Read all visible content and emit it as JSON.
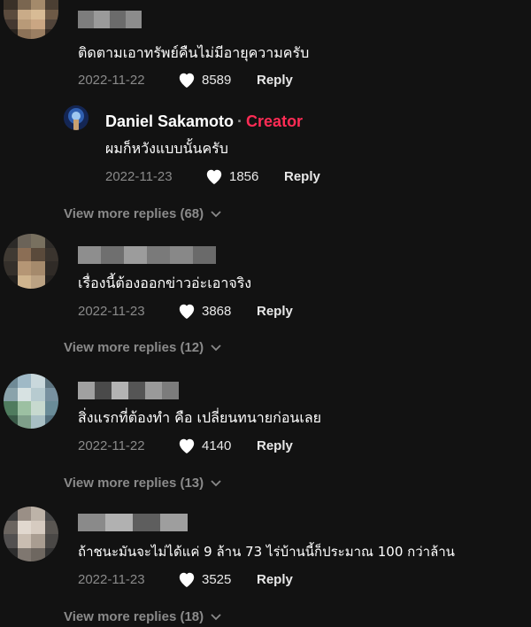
{
  "comments": [
    {
      "text": "ติดตามเอาทรัพย์คืนไม่มีอายุความครับ",
      "date": "2022-11-22",
      "likes": "8589",
      "reply_label": "Reply",
      "replies": [
        {
          "author": "Daniel Sakamoto",
          "separator": "·",
          "badge": "Creator",
          "text": "ผมก็หวังแบบนั้นครับ",
          "date": "2022-11-23",
          "likes": "1856",
          "reply_label": "Reply"
        }
      ],
      "view_more": "View more replies (68)"
    },
    {
      "text": "เรื่องนี้ต้องออกข่าวอ่ะเอาจริง",
      "date": "2022-11-23",
      "likes": "3868",
      "reply_label": "Reply",
      "view_more": "View more replies (12)"
    },
    {
      "text": "สิ่งแรกที่ต้องทำ คือ เปลี่ยนทนายก่อนเลย",
      "date": "2022-11-22",
      "likes": "4140",
      "reply_label": "Reply",
      "view_more": "View more replies (13)"
    },
    {
      "text": "ถ้าชนะมันจะไม่ได้แค่ 9 ล้าน 73 ไร่บ้านนี้ก็ประมาณ 100 กว่าล้าน",
      "date": "2022-11-23",
      "likes": "3525",
      "reply_label": "Reply",
      "view_more": "View more replies (18)"
    }
  ],
  "colors": {
    "background": "#121212",
    "creator_badge": "#fe2c55",
    "muted": "#8a8a8a"
  },
  "icons": {
    "like": "heart-icon",
    "expand": "chevron-down-icon"
  }
}
